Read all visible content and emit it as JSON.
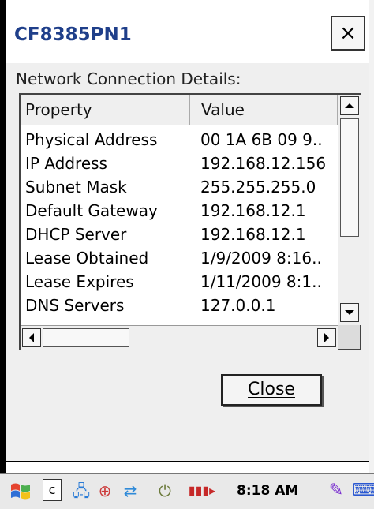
{
  "dialog": {
    "title": "CF8385PN1",
    "close_x": "×",
    "section_label": "Network Connection Details:",
    "columns": [
      "Property",
      "Value"
    ],
    "rows": [
      {
        "property": "Physical Address",
        "value": "00 1A 6B 09 9.."
      },
      {
        "property": "IP Address",
        "value": "192.168.12.156"
      },
      {
        "property": "Subnet Mask",
        "value": "255.255.255.0"
      },
      {
        "property": "Default Gateway",
        "value": "192.168.12.1"
      },
      {
        "property": "DHCP Server",
        "value": "192.168.12.1"
      },
      {
        "property": "Lease Obtained",
        "value": "1/9/2009 8:16.."
      },
      {
        "property": "Lease Expires",
        "value": "1/11/2009 8:1.."
      },
      {
        "property": "DNS Servers",
        "value": "127.0.0.1"
      }
    ],
    "close_button": "Close"
  },
  "taskbar": {
    "start_icon": "windows-flag-icon",
    "c_button": "c",
    "clock": "8:18 AM",
    "icons": [
      "network-icon",
      "globe-icon",
      "connection-icon",
      "power-icon",
      "signal-icon"
    ]
  },
  "colors": {
    "title_text": "#1f3f8a",
    "dialog_bg": "#efefef"
  }
}
